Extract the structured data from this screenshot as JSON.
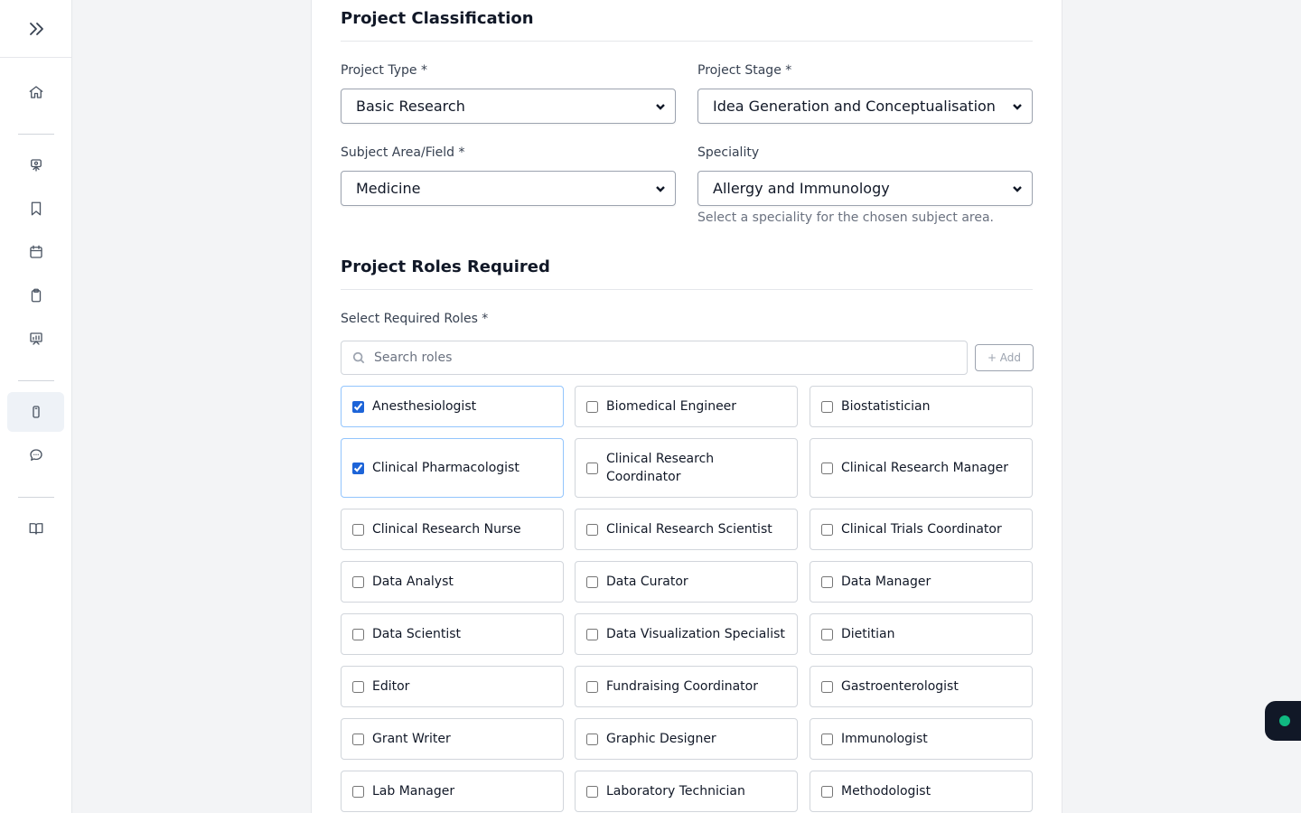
{
  "sidebar": {
    "items": [
      {
        "name": "home-icon"
      },
      {
        "name": "presentation-icon"
      },
      {
        "name": "bookmark-icon"
      },
      {
        "name": "calendar-icon"
      },
      {
        "name": "clipboard-icon"
      },
      {
        "name": "chart-board-icon"
      },
      {
        "name": "phone-icon",
        "active": true
      },
      {
        "name": "chat-icon"
      },
      {
        "name": "book-icon"
      }
    ]
  },
  "classification": {
    "title": "Project Classification",
    "project_type_label": "Project Type *",
    "project_type_value": "Basic Research",
    "project_stage_label": "Project Stage *",
    "project_stage_value": "Idea Generation and Conceptualisation",
    "subject_label": "Subject Area/Field *",
    "subject_value": "Medicine",
    "speciality_label": "Speciality",
    "speciality_value": "Allergy and Immunology",
    "speciality_helper": "Select a speciality for the chosen subject area."
  },
  "roles": {
    "title": "Project Roles Required",
    "select_label": "Select Required Roles *",
    "search_placeholder": "Search roles",
    "add_label": "+ Add",
    "items": [
      {
        "label": "Anesthesiologist",
        "checked": true
      },
      {
        "label": "Biomedical Engineer",
        "checked": false
      },
      {
        "label": "Biostatistician",
        "checked": false
      },
      {
        "label": "Clinical Pharmacologist",
        "checked": true
      },
      {
        "label": "Clinical Research Coordinator",
        "checked": false
      },
      {
        "label": "Clinical Research Manager",
        "checked": false
      },
      {
        "label": "Clinical Research Nurse",
        "checked": false
      },
      {
        "label": "Clinical Research Scientist",
        "checked": false
      },
      {
        "label": "Clinical Trials Coordinator",
        "checked": false
      },
      {
        "label": "Data Analyst",
        "checked": false
      },
      {
        "label": "Data Curator",
        "checked": false
      },
      {
        "label": "Data Manager",
        "checked": false
      },
      {
        "label": "Data Scientist",
        "checked": false
      },
      {
        "label": "Data Visualization Specialist",
        "checked": false
      },
      {
        "label": "Dietitian",
        "checked": false
      },
      {
        "label": "Editor",
        "checked": false
      },
      {
        "label": "Fundraising Coordinator",
        "checked": false
      },
      {
        "label": "Gastroenterologist",
        "checked": false
      },
      {
        "label": "Grant Writer",
        "checked": false
      },
      {
        "label": "Graphic Designer",
        "checked": false
      },
      {
        "label": "Immunologist",
        "checked": false
      },
      {
        "label": "Lab Manager",
        "checked": false
      },
      {
        "label": "Laboratory Technician",
        "checked": false
      },
      {
        "label": "Methodologist",
        "checked": false
      }
    ]
  },
  "colors": {
    "accent": "#1d64d8",
    "status_dot": "#10b981"
  }
}
